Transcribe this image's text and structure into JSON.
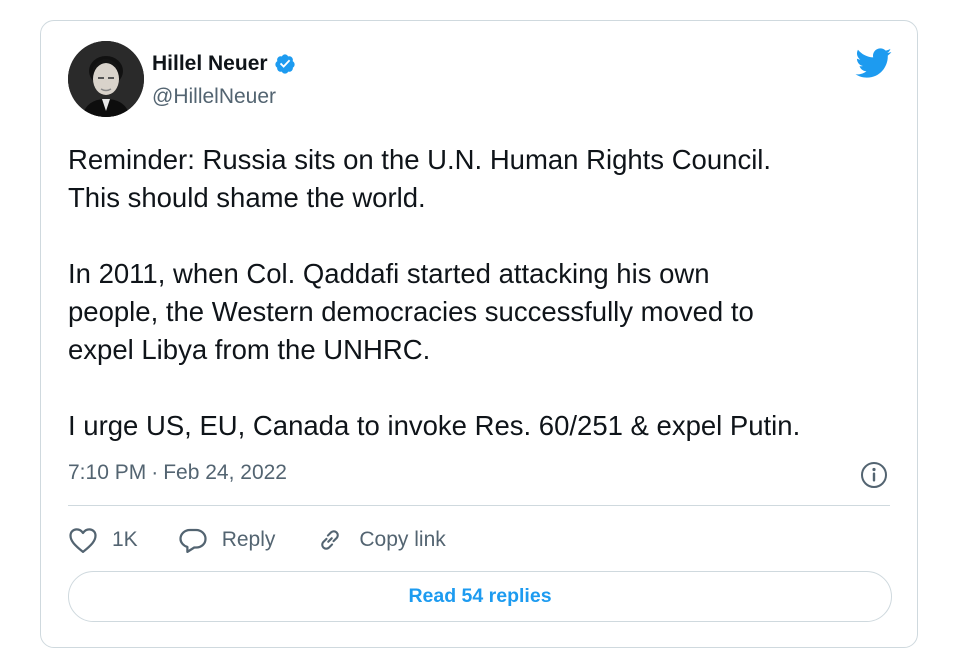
{
  "author": {
    "name": "Hillel Neuer",
    "handle": "@HillelNeuer",
    "verified": true
  },
  "tweet": {
    "paragraphs": [
      [
        "Reminder: Russia sits on the U.N. Human Rights Council.",
        "This should shame the world."
      ],
      [
        "In 2011, when Col. Qaddafi started attacking his own",
        "people, the Western democracies successfully moved to",
        "expel Libya from the UNHRC."
      ],
      [
        "I urge US, EU, Canada to invoke Res. 60/251 & expel Putin."
      ]
    ],
    "time": "7:10 PM",
    "separator": "·",
    "date": "Feb 24, 2022"
  },
  "actions": {
    "likes": "1K",
    "reply_label": "Reply",
    "copy_link_label": "Copy link"
  },
  "read_replies_label": "Read 54 replies",
  "colors": {
    "accent": "#1d9bf0",
    "text": "#0f1419",
    "muted": "#536471",
    "border": "#cfd9de"
  },
  "icons": [
    "twitter-bird-icon",
    "verified-badge-icon",
    "info-icon",
    "heart-icon",
    "reply-icon",
    "link-icon"
  ]
}
